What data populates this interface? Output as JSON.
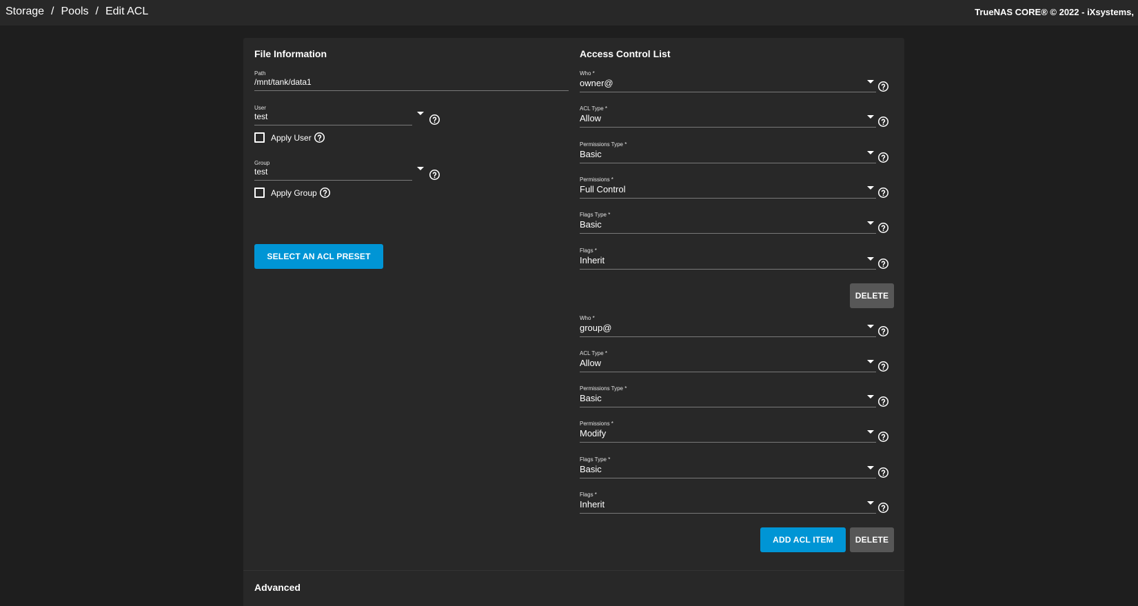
{
  "breadcrumb": [
    "Storage",
    "Pools",
    "Edit ACL"
  ],
  "breadcrumb_separator": "/",
  "copyright": "TrueNAS CORE® © 2022 - iXsystems,",
  "file_info": {
    "title": "File Information",
    "path_label": "Path",
    "path_value": "/mnt/tank/data1",
    "user_label": "User",
    "user_value": "test",
    "apply_user_label": "Apply User",
    "group_label": "Group",
    "group_value": "test",
    "apply_group_label": "Apply Group",
    "preset_button": "SELECT AN ACL PRESET"
  },
  "acl": {
    "title": "Access Control List",
    "items": [
      {
        "who_label": "Who *",
        "who": "owner@",
        "acl_type_label": "ACL Type *",
        "acl_type": "Allow",
        "perm_type_label": "Permissions Type *",
        "perm_type": "Basic",
        "perms_label": "Permissions *",
        "perms": "Full Control",
        "flags_type_label": "Flags Type *",
        "flags_type": "Basic",
        "flags_label": "Flags *",
        "flags": "Inherit",
        "delete_label": "DELETE"
      },
      {
        "who_label": "Who *",
        "who": "group@",
        "acl_type_label": "ACL Type *",
        "acl_type": "Allow",
        "perm_type_label": "Permissions Type *",
        "perm_type": "Basic",
        "perms_label": "Permissions *",
        "perms": "Modify",
        "flags_type_label": "Flags Type *",
        "flags_type": "Basic",
        "flags_label": "Flags *",
        "flags": "Inherit",
        "delete_label": "DELETE"
      }
    ],
    "add_button": "ADD ACL ITEM"
  },
  "advanced": {
    "title": "Advanced"
  },
  "colors": {
    "accent": "#0095d5",
    "background": "#1e1e1e",
    "card": "#282828",
    "secondary_button": "#575757"
  },
  "icons": {
    "help": "help-circle-icon",
    "dropdown": "caret-down-icon",
    "checkbox": "checkbox-unchecked-icon"
  }
}
